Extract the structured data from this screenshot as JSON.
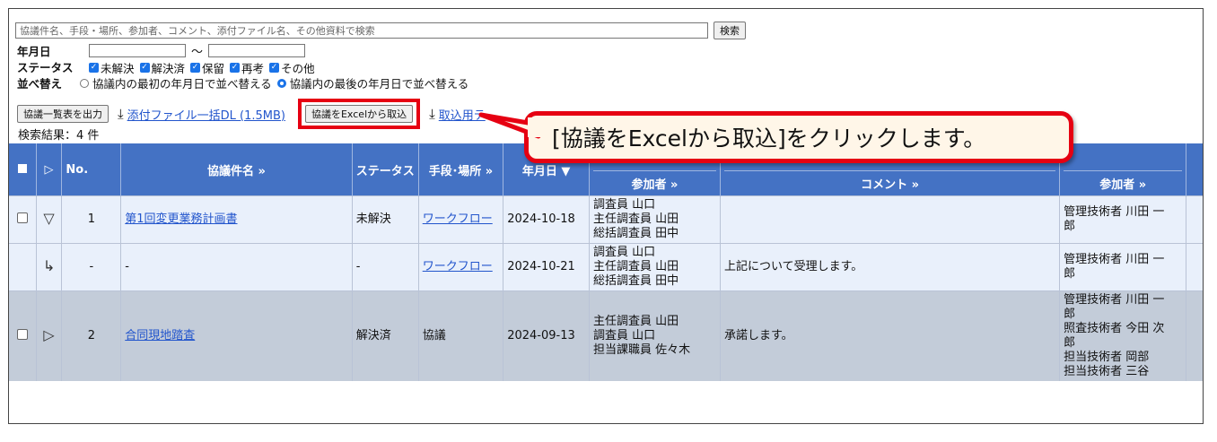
{
  "search": {
    "placeholder": "協議件名、手段・場所、参加者、コメント、添付ファイル名、その他資料で検索",
    "button_label": "検索"
  },
  "filters": {
    "date_label": "年月日",
    "date_separator": "～",
    "status_label": "ステータス",
    "status_options": [
      {
        "label": "未解決",
        "checked": true
      },
      {
        "label": "解決済",
        "checked": true
      },
      {
        "label": "保留",
        "checked": true
      },
      {
        "label": "再考",
        "checked": true
      },
      {
        "label": "その他",
        "checked": true
      }
    ],
    "sort_label": "並べ替え",
    "sort_options": [
      {
        "label": "協議内の最初の年月日で並べ替える",
        "selected": false
      },
      {
        "label": "協議内の最後の年月日で並べ替える",
        "selected": true
      }
    ]
  },
  "toolbar": {
    "export_list_label": "協議一覧表を出力",
    "download_all_label": "添付ファイル一括DL (1.5MB)",
    "import_excel_label": "協議をExcelから取込",
    "import_template_label": "取込用テ"
  },
  "results": {
    "count_label": "検索結果：4 件"
  },
  "callout": {
    "text": "[協議をExcelから取込]をクリックします。"
  },
  "table": {
    "headers": {
      "no": "No.",
      "title": "協議件名 »",
      "status": "ステータス",
      "method": "手段･場所 »",
      "date": "年月日 ▼",
      "participants": "参加者 »",
      "comment": "コメント »",
      "participants2": "参加者 »"
    },
    "rows": [
      {
        "expand": "▽",
        "no": "1",
        "title": "第1回変更業務計画書",
        "status": "未解決",
        "method": "ワークフロー",
        "date": "2024-10-18",
        "participants": [
          "調査員 山口",
          "主任調査員 山田",
          "総括調査員 田中"
        ],
        "comment": "",
        "participants2": [
          "管理技術者 川田 一",
          "郎"
        ]
      },
      {
        "expand": "↳",
        "no": "-",
        "title": "",
        "status": "-",
        "method": "ワークフロー",
        "date": "2024-10-21",
        "participants": [
          "調査員 山口",
          "主任調査員 山田",
          "総括調査員 田中"
        ],
        "comment": "上記について受理します。",
        "participants2": [
          "管理技術者 川田 一",
          "郎"
        ]
      },
      {
        "expand": "▷",
        "no": "2",
        "title": "合同現地踏査",
        "status": "解決済",
        "method": "協議",
        "date": "2024-09-13",
        "participants": [
          "主任調査員 山田",
          "調査員 山口",
          "担当課職員 佐々木"
        ],
        "comment": "承諾します。",
        "participants2": [
          "管理技術者 川田 一",
          "郎",
          "照査技術者 今田 次",
          "郎",
          "担当技術者 岡部",
          "担当技術者 三谷"
        ]
      }
    ]
  }
}
